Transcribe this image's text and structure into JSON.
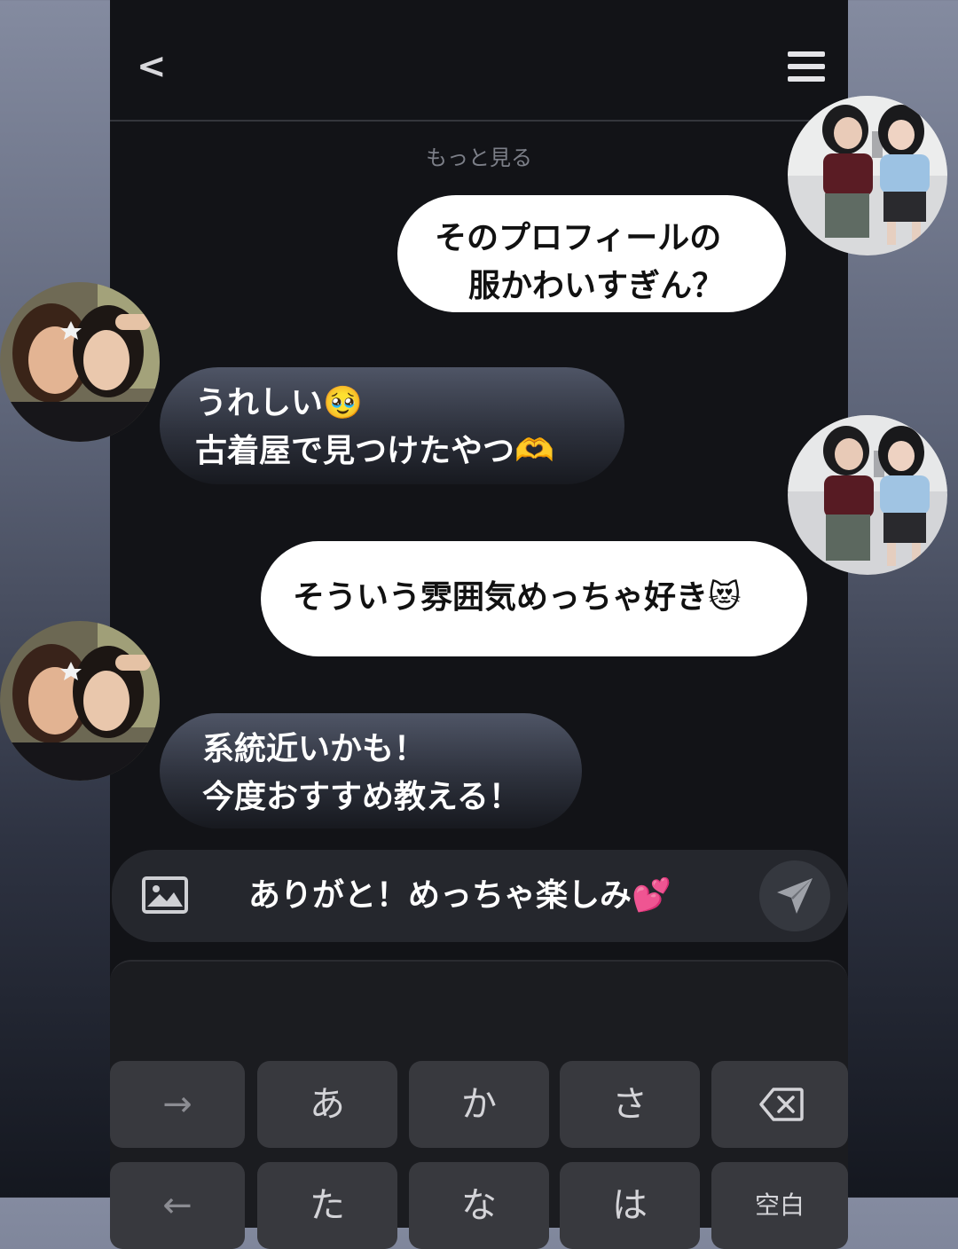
{
  "header": {
    "back_label": "<"
  },
  "more_label": "もっと見る",
  "messages": [
    {
      "lines": [
        "そのプロフィールの",
        "服かわいすぎん？"
      ]
    },
    {
      "lines": [
        "うれしい🥹",
        "古着屋で見つけたやつ🫶"
      ]
    },
    {
      "lines": [
        "そういう雰囲気めっちゃ好き😻"
      ]
    },
    {
      "lines": [
        "系統近いかも！",
        "今度おすすめ教える！"
      ]
    }
  ],
  "input": {
    "value": "ありがと！めっちゃ楽しみ💕"
  },
  "keyboard": {
    "row1": [
      "→",
      "あ",
      "か",
      "さ"
    ],
    "row2": [
      "←",
      "た",
      "な",
      "は",
      "空白"
    ]
  },
  "colors": {
    "outgoing_bubble": "#ffffff",
    "incoming_bubble": "#3a3e4b",
    "phone_bg": "#121317",
    "key_bg": "#38393e"
  },
  "icons": {
    "back": "chevron-left-icon",
    "menu": "hamburger-menu-icon",
    "image": "image-icon",
    "send": "send-arrow-icon",
    "backspace": "backspace-icon"
  }
}
